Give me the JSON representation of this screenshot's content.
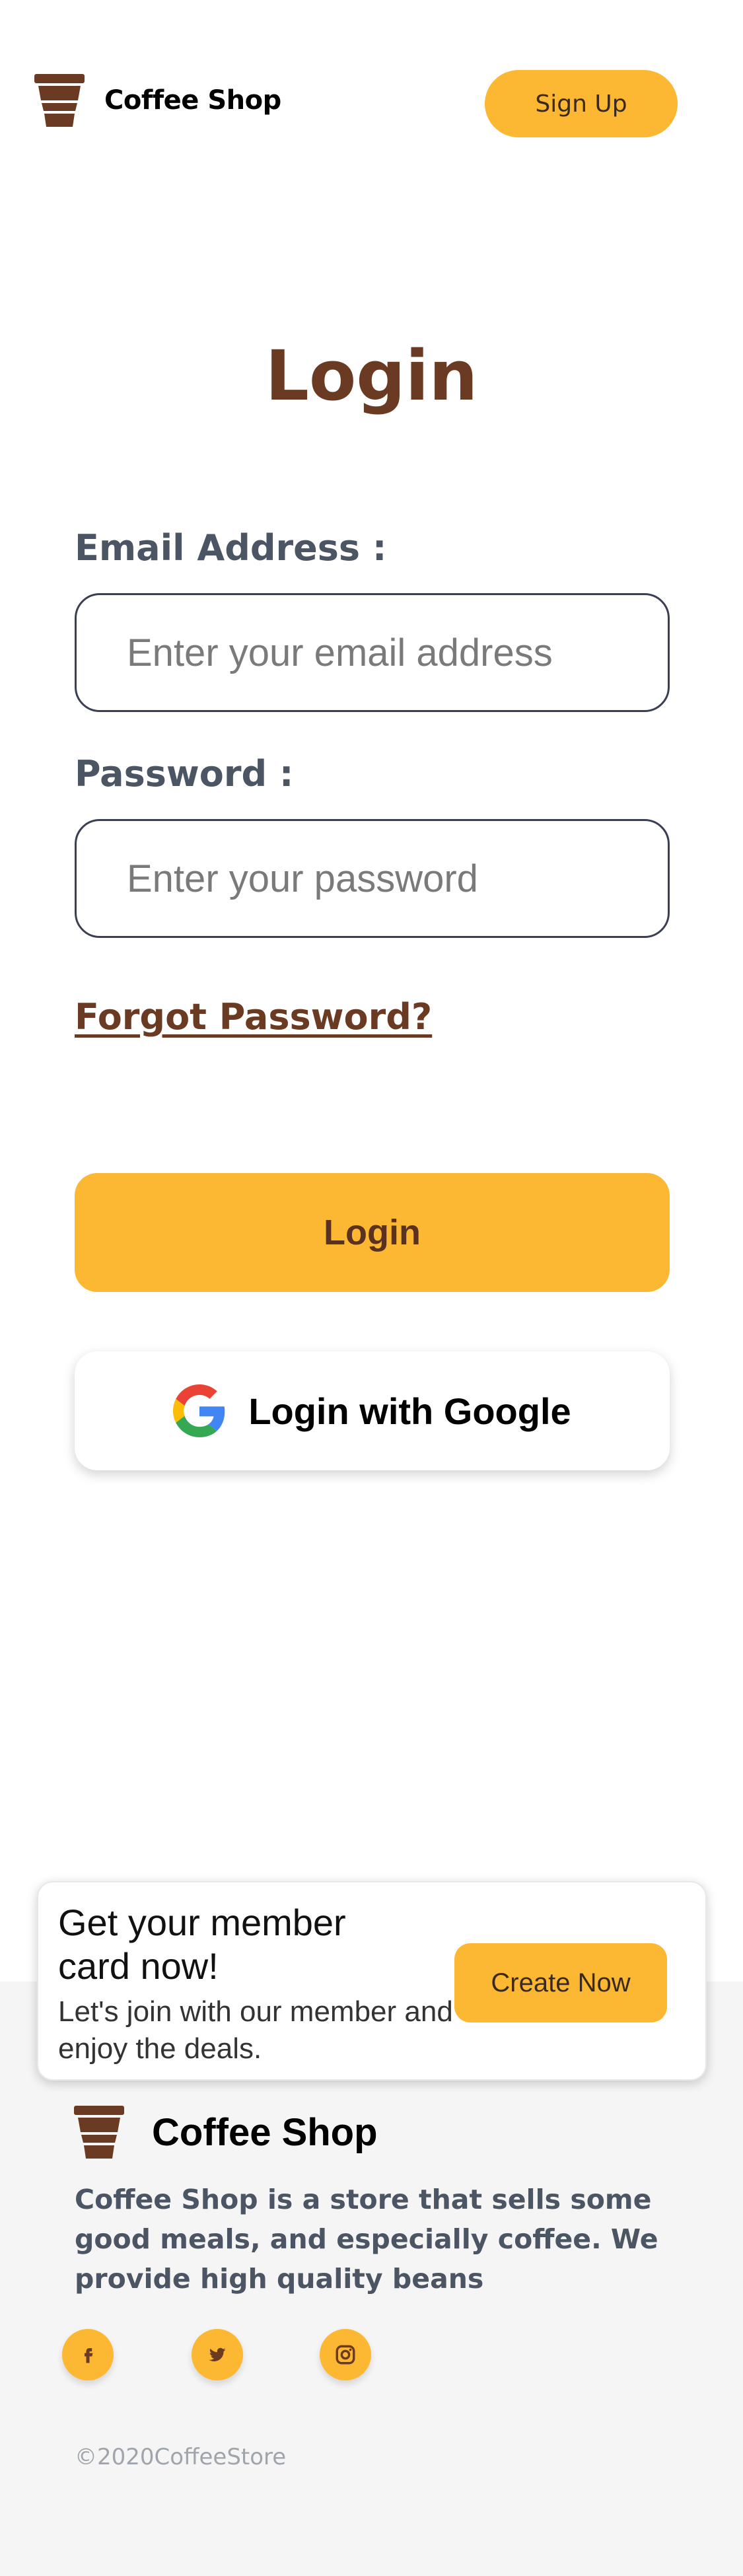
{
  "header": {
    "brand": "Coffee Shop",
    "signup_label": "Sign Up",
    "logo_icon": "coffee-cup-icon"
  },
  "login": {
    "title": "Login",
    "email_label": "Email Address :",
    "email_placeholder": "Enter your email address",
    "email_value": "",
    "password_label": "Password :",
    "password_placeholder": "Enter your password",
    "password_value": "",
    "forgot_label": "Forgot Password?",
    "login_button": "Login",
    "google_button": "Login with Google"
  },
  "member": {
    "title": "Get your member card now!",
    "subtitle": "Let's join with our member and enjoy the deals.",
    "button": "Create Now"
  },
  "footer": {
    "brand": "Coffee Shop",
    "description": "Coffee Shop is a store that sells some good meals, and especially coffee. We provide high quality beans",
    "social": [
      "facebook-icon",
      "twitter-icon",
      "instagram-icon"
    ],
    "copyright": "©2020CoffeeStore"
  },
  "colors": {
    "accent": "#fdb833",
    "brown": "#6a3a22",
    "text_gray": "#4b5563"
  }
}
